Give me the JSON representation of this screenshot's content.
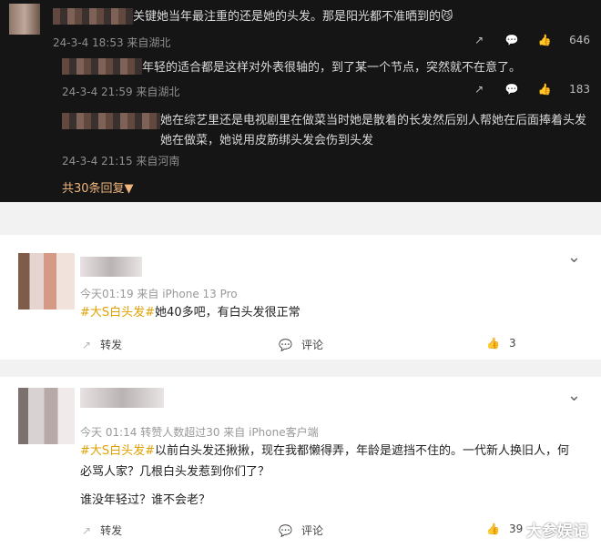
{
  "dark": {
    "items": [
      {
        "text": "关键她当年最注重的还是她的头发。那是阳光都不准晒到的😼",
        "meta": "24-3-4 18:53 来自湖北",
        "likes": "646"
      },
      {
        "text": "年轻的适合都是这样对外表很轴的，到了某一个节点，突然就不在意了。",
        "meta": "24-3-4 21:59 来自湖北",
        "likes": "183"
      },
      {
        "text": "她在综艺里还是电视剧里在做菜当时她是散着的长发然后别人帮她在后面捧着头发她在做菜，她说用皮筋绑头发会伤到头发",
        "meta": "24-3-4 21:15 来自河南"
      }
    ],
    "total": "共30条回复▼"
  },
  "comments": [
    {
      "time": "今天01:19 来自 iPhone 13 Pro",
      "hashtag": "#大S白头发#",
      "text": "她40多吧，有白头发很正常",
      "repost": "转发",
      "comment": "评论",
      "likes": "3"
    },
    {
      "time": "今天 01:14 转赞人数超过30 来自 iPhone客户端",
      "hashtag": "#大S白头发#",
      "text": "以前白头发还揪揪，现在我都懒得弄，年龄是遮挡不住的。一代新人换旧人，何必骂人家？几根白头发惹到你们了？",
      "text2": "谁没年轻过？谁不会老？",
      "repost": "转发",
      "comment": "评论",
      "likes": "39"
    }
  ],
  "watermark": "大参娱记"
}
